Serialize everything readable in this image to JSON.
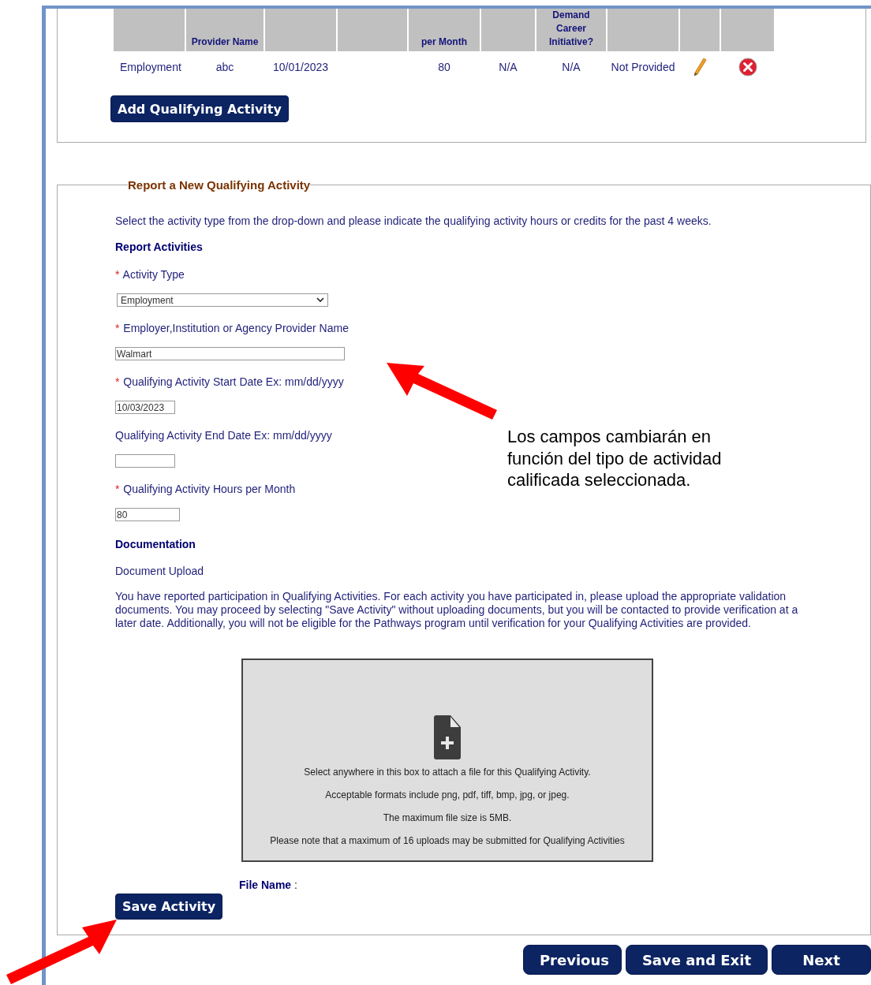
{
  "activities_table": {
    "columns": [
      {},
      {
        "label": "Provider Name"
      },
      {},
      {},
      {
        "label": "per Month"
      },
      {},
      {
        "label": "Demand Career Initiative?"
      },
      {},
      {},
      {}
    ],
    "rows": [
      {
        "cells": [
          "Employment",
          "abc",
          "10/01/2023",
          "",
          "80",
          "N/A",
          "N/A",
          "Not Provided"
        ]
      }
    ]
  },
  "add_button": "Add Qualifying Activity",
  "report_section": {
    "legend": "Report a New Qualifying Activity",
    "intro": "Select the activity type from the drop-down and please indicate the qualifying activity hours or credits for the past 4 weeks.",
    "heading": "Report Activities",
    "fields": [
      {
        "kind": "select",
        "marker": "*",
        "label": "Activity Type",
        "value": "Employment"
      },
      {
        "kind": "text",
        "marker": "*",
        "label": "Employer,Institution or Agency Provider Name",
        "value": "Walmart"
      },
      {
        "kind": "date",
        "marker": "*",
        "label": "Qualifying Activity Start Date Ex: mm/dd/yyyy",
        "value": "10/03/2023"
      },
      {
        "kind": "date",
        "label": "Qualifying Activity End Date Ex: mm/dd/yyyy"
      },
      {
        "kind": "number",
        "marker": "*",
        "label": "Qualifying Activity Hours per Month",
        "value": "80"
      }
    ],
    "doc_heading": "Documentation",
    "doc_label": "Document Upload",
    "doc_text": "You have reported participation in Qualifying Activities. For each activity you have participated in, please upload the appropriate validation documents. You may proceed by selecting \"Save Activity\" without uploading documents, but you will be contacted to provide verification at a later date. Additionally, you will not be eligible for the Pathways program until verification for your Qualifying Activities are provided.",
    "upload_box": [
      "Select anywhere in this box to attach a file for this Qualifying Activity.",
      "Acceptable formats include png, pdf, tiff, bmp, jpg, or jpeg.",
      "The maximum file size is 5MB.",
      "Please note that a maximum of 16 uploads may be submitted for Qualifying Activities"
    ],
    "file_name_label": "File Name",
    "file_name_sep": ":",
    "save_button": "Save Activity"
  },
  "annotation": "Los campos cambiarán en función del tipo de actividad calificada seleccionada.",
  "nav_buttons": [
    "Previous",
    "Save and Exit",
    "Next"
  ]
}
